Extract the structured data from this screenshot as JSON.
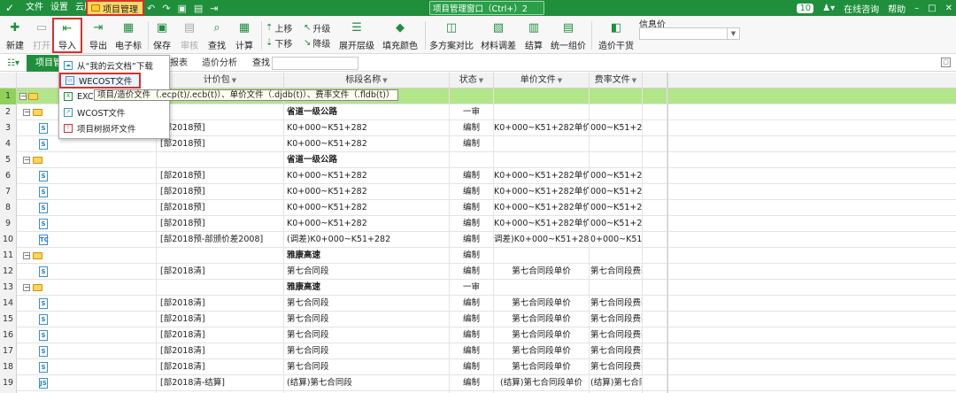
{
  "topbar": {
    "menus": [
      "文件",
      "设置",
      "云服务"
    ],
    "project_tab": "项目管理",
    "center_title": "项目管理窗口（Ctrl+",
    "center_suffix": "）2",
    "right": {
      "badge": "10",
      "online": "在线咨询",
      "help": "帮助"
    }
  },
  "ribbon": {
    "new": "新建",
    "open": "打开",
    "import": "导入",
    "export": "导出",
    "etender": "电子标",
    "save": "保存",
    "audit": "审核",
    "find": "查找",
    "calc": "计算",
    "move_up": "上移",
    "move_down": "下移",
    "upgrade": "升级",
    "downgrade": "降级",
    "expand_level": "展开层级",
    "fill_color": "填充颜色",
    "multi_compare": "多方案对比",
    "material_adjust": "材料调差",
    "settle": "结算",
    "unify_price": "统一组价",
    "cost_check": "造价干货",
    "info_price_label": "信息价"
  },
  "subbar": {
    "active_tab": "项目管理",
    "tab2": "报表",
    "tab3": "造价分析",
    "search_label": "查找"
  },
  "dropdown": {
    "cloud_download": "从“我的云文档”下载",
    "wecost_item": "WECOST文件",
    "excel_item": "EXCEL",
    "wcost_item": "WCOST文件",
    "tree_item": "项目树损坏文件",
    "tooltip": "项目/造价文件（.ecp(t)/.ecb(t)）、单价文件（.djdb(t)）、费率文件（.fldb(t)）"
  },
  "grid": {
    "headers": {
      "package": "计价包",
      "section": "标段名称",
      "status": "状态",
      "unit_price": "单价文件",
      "fee_rate": "费率文件"
    },
    "rows": [
      {
        "n": "1",
        "pkg": "",
        "sec": "",
        "st": "",
        "up": "",
        "fee": ""
      },
      {
        "n": "2",
        "pkg": "",
        "sec": "省道一级公路",
        "st": "一审",
        "up": "",
        "fee": ""
      },
      {
        "n": "3",
        "pkg": "[部2018预]",
        "sec": "K0+000~K51+282",
        "st": "编制",
        "up": "K0+000~K51+282单价",
        "fee": "000~K51+282"
      },
      {
        "n": "4",
        "pkg": "[部2018预]",
        "sec": "K0+000~K51+282",
        "st": "编制",
        "up": "",
        "fee": ""
      },
      {
        "n": "5",
        "pkg": "",
        "sec": "省道一级公路",
        "st": "",
        "up": "",
        "fee": ""
      },
      {
        "n": "6",
        "pkg": "[部2018预]",
        "sec": "K0+000~K51+282",
        "st": "编制",
        "up": "K0+000~K51+282单价",
        "fee": "000~K51+282"
      },
      {
        "n": "7",
        "pkg": "[部2018预]",
        "sec": "K0+000~K51+282",
        "st": "编制",
        "up": "K0+000~K51+282单价",
        "fee": "000~K51+282"
      },
      {
        "n": "8",
        "pkg": "[部2018预]",
        "sec": "K0+000~K51+282",
        "st": "编制",
        "up": "K0+000~K51+282单价",
        "fee": "000~K51+282"
      },
      {
        "n": "9",
        "pkg": "[部2018预]",
        "sec": "K0+000~K51+282",
        "st": "编制",
        "up": "K0+000~K51+282单价",
        "fee": "000~K51+282"
      },
      {
        "n": "10",
        "pkg": "[部2018预-部颁价差2008]",
        "sec": "(调差)K0+000~K51+282",
        "st": "编制",
        "up": "调差)K0+000~K51+282单价",
        "fee": "0+000~K51+2"
      },
      {
        "n": "11",
        "pkg": "",
        "sec": "雅康高速",
        "st": "编制",
        "up": "",
        "fee": ""
      },
      {
        "n": "12",
        "pkg": "[部2018清]",
        "sec": "第七合同段",
        "st": "编制",
        "up": "第七合同段单价",
        "fee": "第七合同段费率"
      },
      {
        "n": "13",
        "pkg": "",
        "sec": "雅康高速",
        "st": "一审",
        "up": "",
        "fee": ""
      },
      {
        "n": "14",
        "pkg": "[部2018清]",
        "sec": "第七合同段",
        "st": "编制",
        "up": "第七合同段单价",
        "fee": "第七合同段费率"
      },
      {
        "n": "15",
        "pkg": "[部2018清]",
        "sec": "第七合同段",
        "st": "编制",
        "up": "第七合同段单价",
        "fee": "第七合同段费率"
      },
      {
        "n": "16",
        "pkg": "[部2018清]",
        "sec": "第七合同段",
        "st": "编制",
        "up": "第七合同段单价",
        "fee": "第七合同段费率"
      },
      {
        "n": "17",
        "pkg": "[部2018清]",
        "sec": "第七合同段",
        "st": "编制",
        "up": "第七合同段单价",
        "fee": "第七合同段费率"
      },
      {
        "n": "18",
        "pkg": "[部2018清]",
        "sec": "第七合同段",
        "st": "编制",
        "up": "第七合同段单价",
        "fee": "第七合同段费率"
      },
      {
        "n": "19",
        "pkg": "[部2018清-结算]",
        "sec": "(结算)第七合同段",
        "st": "编制",
        "up": "(结算)第七合同段单价",
        "fee": "(结算)第七合同段费"
      },
      {
        "n": "20",
        "pkg": "[部2018清-结算]",
        "sec": "(结算)第七合同段",
        "st": "编制",
        "up": "(结算)第七合同段单价",
        "fee": "(结算)第七合同段费"
      }
    ]
  }
}
